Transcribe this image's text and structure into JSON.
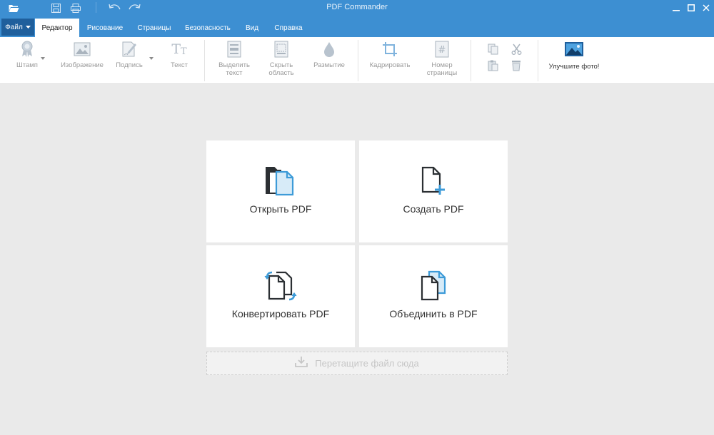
{
  "window": {
    "title": "PDF Commander"
  },
  "quick_access": [
    {
      "name": "open-folder-icon"
    },
    {
      "name": "save-icon"
    },
    {
      "name": "print-icon"
    },
    {
      "name": "undo-icon"
    },
    {
      "name": "redo-icon"
    }
  ],
  "window_controls": [
    "minimize-icon",
    "maximize-icon",
    "close-icon"
  ],
  "menu": {
    "file_label": "Файл",
    "tabs": [
      {
        "label": "Редактор",
        "active": true
      },
      {
        "label": "Рисование"
      },
      {
        "label": "Страницы"
      },
      {
        "label": "Безопасность"
      },
      {
        "label": "Вид"
      },
      {
        "label": "Справка"
      }
    ]
  },
  "ribbon": {
    "stamp": "Штамп",
    "image": "Изображение",
    "signature": "Подпись",
    "text": "Текст",
    "select_text": [
      "Выделить",
      "текст"
    ],
    "hide_area": [
      "Скрыть",
      "область"
    ],
    "blur": "Размытие",
    "crop": "Кадрировать",
    "page_number": [
      "Номер",
      "страницы"
    ],
    "enhance_photo": "Улучшите фото!"
  },
  "actions": {
    "open_pdf": "Открыть PDF",
    "create_pdf": "Создать PDF",
    "convert_pdf": "Конвертировать PDF",
    "merge_pdf": "Объединить в PDF"
  },
  "dropzone": {
    "label": "Перетащите файл сюда"
  },
  "colors": {
    "accent": "#3d8fd2",
    "file_button": "#1f5f9c",
    "icon_blue": "#3d9bd8"
  }
}
